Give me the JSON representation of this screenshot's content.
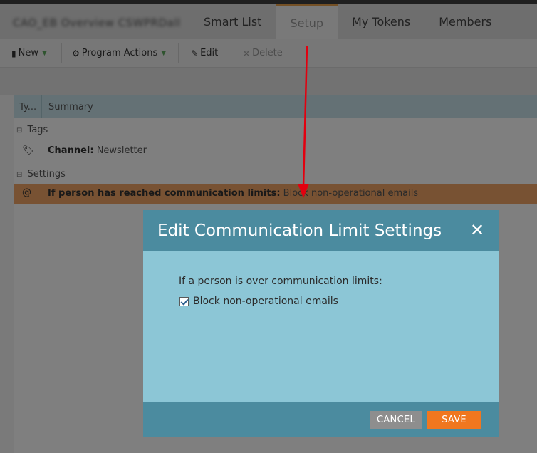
{
  "header": {
    "program_name": "CAO_EB Overview CSWPRDall",
    "tabs": [
      {
        "label": "Smart List"
      },
      {
        "label": "Setup"
      },
      {
        "label": "My Tokens"
      },
      {
        "label": "Members"
      }
    ]
  },
  "toolbar": {
    "new_label": "New",
    "program_actions_label": "Program Actions",
    "edit_label": "Edit",
    "delete_label": "Delete"
  },
  "grid": {
    "col_type": "Ty...",
    "col_summary": "Summary",
    "groups": [
      {
        "label": "Tags",
        "items": [
          {
            "name": "Channel:",
            "value": "Newsletter"
          }
        ]
      },
      {
        "label": "Settings",
        "items": [
          {
            "name": "If person has reached communication limits:",
            "value": "Block non-operational emails"
          }
        ]
      }
    ]
  },
  "modal": {
    "title": "Edit Communication Limit Settings",
    "close_symbol": "✕",
    "prompt": "If a person is over communication limits:",
    "checkbox_label": "Block non-operational emails",
    "checkbox_checked": true,
    "cancel_label": "CANCEL",
    "save_label": "SAVE"
  },
  "colors": {
    "modal_header": "#4b8b9f",
    "modal_body": "#8cc6d6",
    "save_button": "#f0771f",
    "cancel_button": "#8e8e8e",
    "selected_row": "#f0a566",
    "annotation_arrow": "#e3000f"
  }
}
